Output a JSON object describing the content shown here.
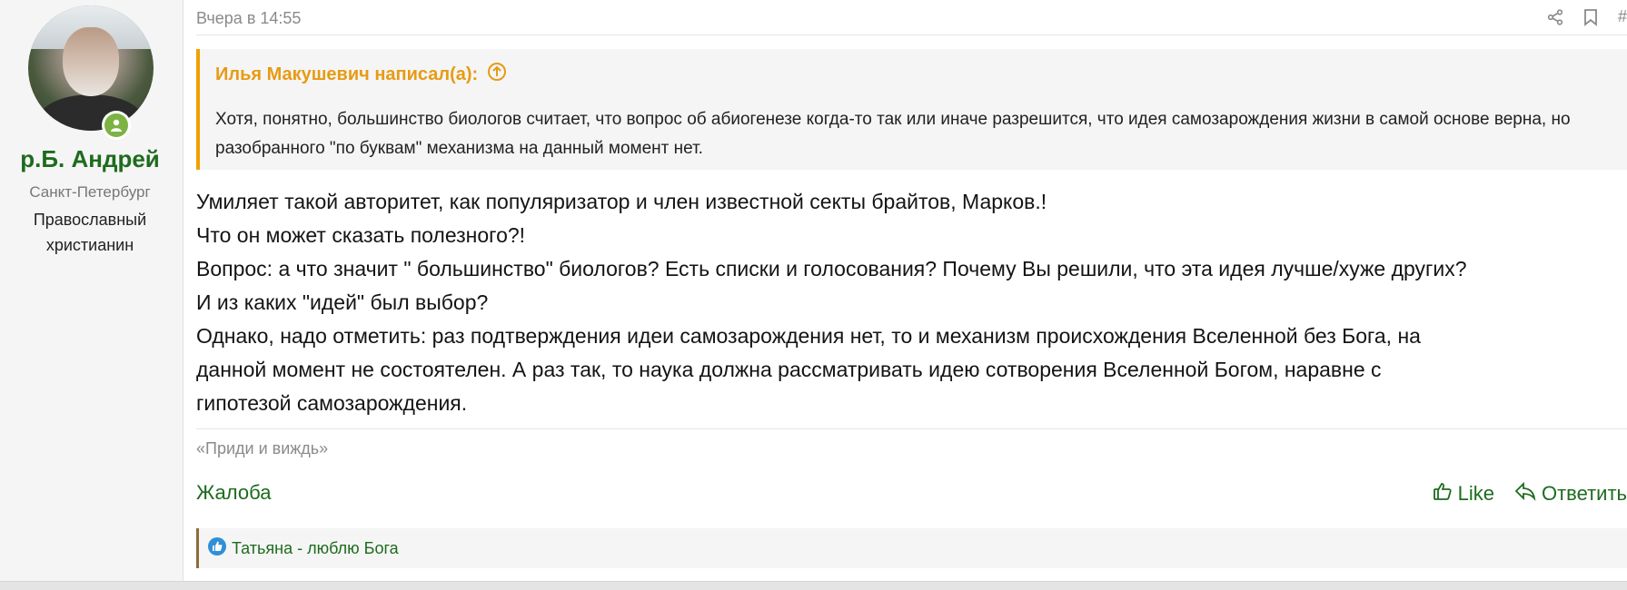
{
  "user": {
    "name": "р.Б. Андрей",
    "location": "Санкт-Петербург",
    "title": "Православный христианин"
  },
  "meta": {
    "date": "Вчера в 14:55",
    "post_anchor": "#"
  },
  "quote": {
    "author": "Илья Макушевич написал(а):",
    "text": "Хотя, понятно, большинство биологов считает, что вопрос об абиогенезе когда-то так или иначе разрешится, что идея самозарождения жизни в самой основе верна, но разобранного \"по буквам\" механизма на данный момент нет."
  },
  "body": {
    "lines": [
      "Умиляет такой авторитет, как популяризатор и член известной секты брайтов, Марков.!",
      "Что он может сказать полезного?!",
      "Вопрос: а что значит \" большинство\" биологов? Есть списки и голосования? Почему Вы решили, что эта идея лучше/хуже других?",
      "И из каких \"идей\" был выбор?",
      "Однако, надо отметить: раз подтверждения идеи самозарождения нет, то и механизм происхождения Вселенной без Бога, на",
      "данной момент не состоятелен. А раз так, то наука должна рассматривать идею сотворения Вселенной Богом, наравне с",
      "гипотезой самозарождения."
    ]
  },
  "signature": "«Приди и виждь»",
  "actions": {
    "report": "Жалоба",
    "like": "Like",
    "reply": "Ответить"
  },
  "reactions": {
    "text": "Татьяна - люблю Бога"
  },
  "colors": {
    "accent_green": "#1e6b1e",
    "quote_border": "#f0a000",
    "quote_author": "#e79b13",
    "online": "#7cb342",
    "reaction_blue": "#2f8fd8"
  }
}
